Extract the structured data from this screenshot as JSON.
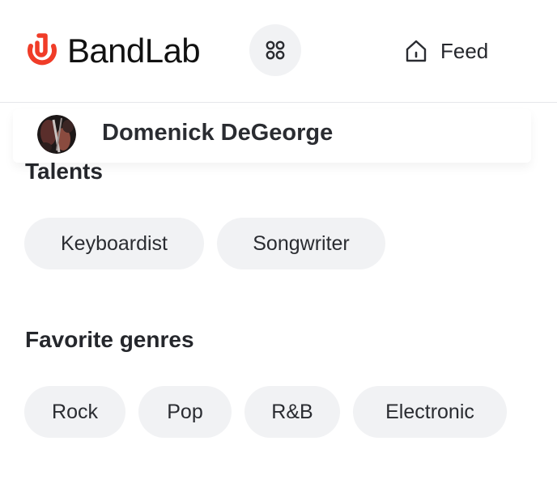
{
  "header": {
    "brand": {
      "name": "BandLab",
      "icon": "bandlab-logo-icon",
      "color": "#f03c28"
    },
    "apps_button": {
      "icon": "apps-grid-icon"
    },
    "nav": {
      "feed_label": "Feed",
      "feed_icon": "home-icon"
    }
  },
  "profile": {
    "name": "Domenick DeGeorge",
    "avatar": "avatar"
  },
  "talents": {
    "title": "Talents",
    "items": [
      "Keyboardist",
      "Songwriter"
    ]
  },
  "genres": {
    "title": "Favorite genres",
    "items": [
      "Rock",
      "Pop",
      "R&B",
      "Electronic"
    ]
  }
}
